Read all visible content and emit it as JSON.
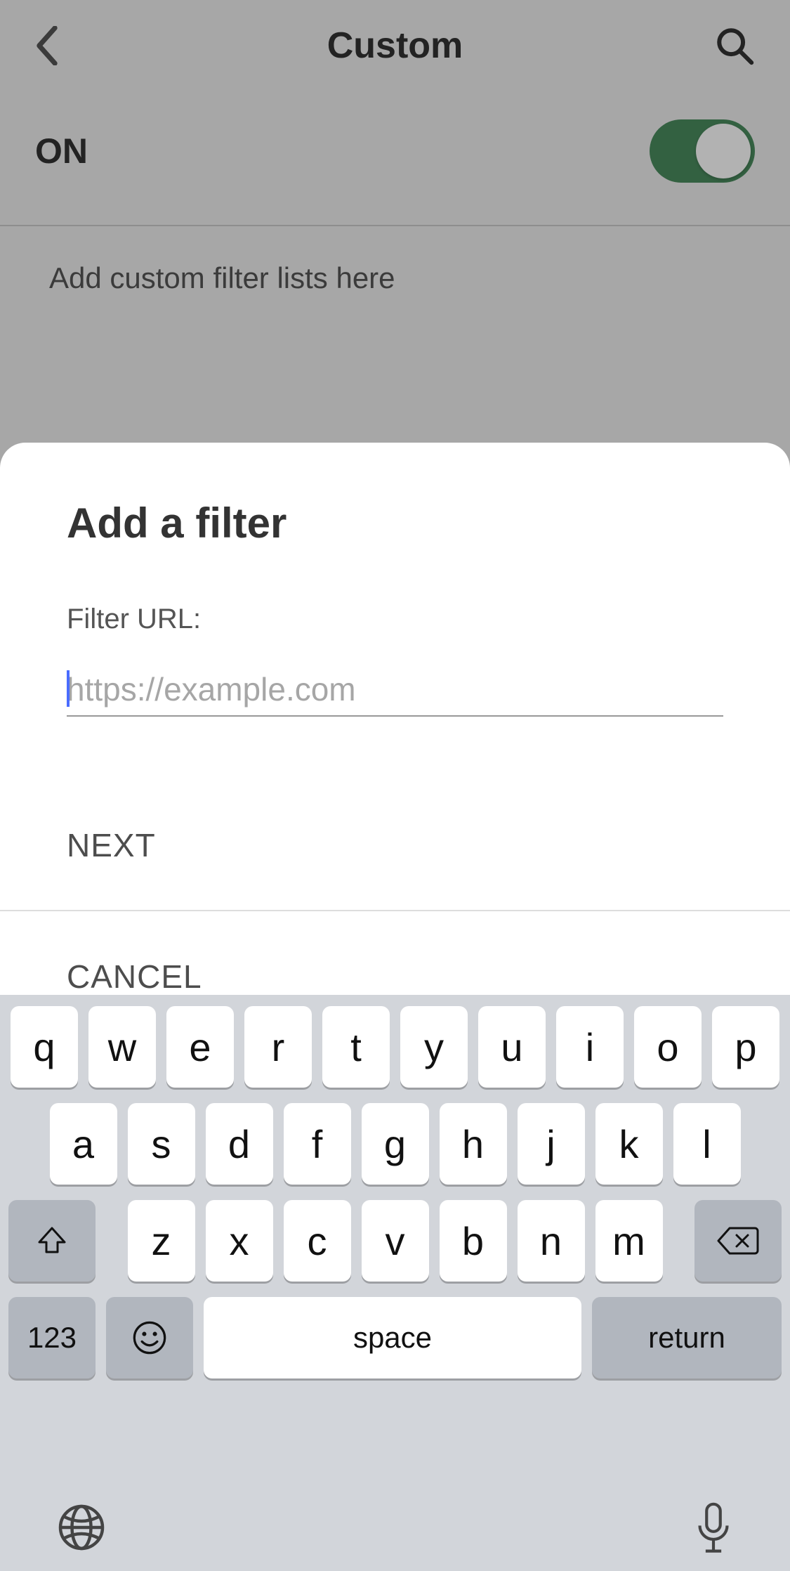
{
  "header": {
    "title": "Custom"
  },
  "onRow": {
    "label": "ON",
    "enabled": true
  },
  "hint": "Add custom filter lists here",
  "modal": {
    "title": "Add a filter",
    "field_label": "Filter URL:",
    "placeholder": "https://example.com",
    "value": "",
    "next_label": "NEXT",
    "cancel_label": "CANCEL"
  },
  "keyboard": {
    "row1": [
      "q",
      "w",
      "e",
      "r",
      "t",
      "y",
      "u",
      "i",
      "o",
      "p"
    ],
    "row2": [
      "a",
      "s",
      "d",
      "f",
      "g",
      "h",
      "j",
      "k",
      "l"
    ],
    "row3": [
      "z",
      "x",
      "c",
      "v",
      "b",
      "n",
      "m"
    ],
    "k123": "123",
    "space": "space",
    "return": "return"
  }
}
